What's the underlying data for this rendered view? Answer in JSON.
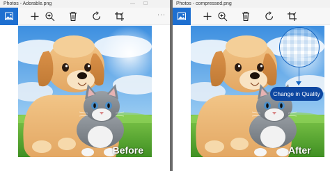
{
  "left_window": {
    "title": "Photos - Adorable.png",
    "caption": "Before",
    "more_label": "···"
  },
  "right_window": {
    "title": "Photos - compressed.png",
    "caption": "After",
    "callout_label": "Change in Quality"
  },
  "window_controls": {
    "minimize": "—",
    "maximize": "☐"
  },
  "toolbar_icons": [
    "image-icon",
    "plus-icon",
    "zoom-in-icon",
    "delete-icon",
    "rotate-icon",
    "crop-icon",
    "more-icon"
  ],
  "colors": {
    "accent": "#1e6fd0",
    "callout": "#0d47a1",
    "divider": "#6b6b6b"
  }
}
